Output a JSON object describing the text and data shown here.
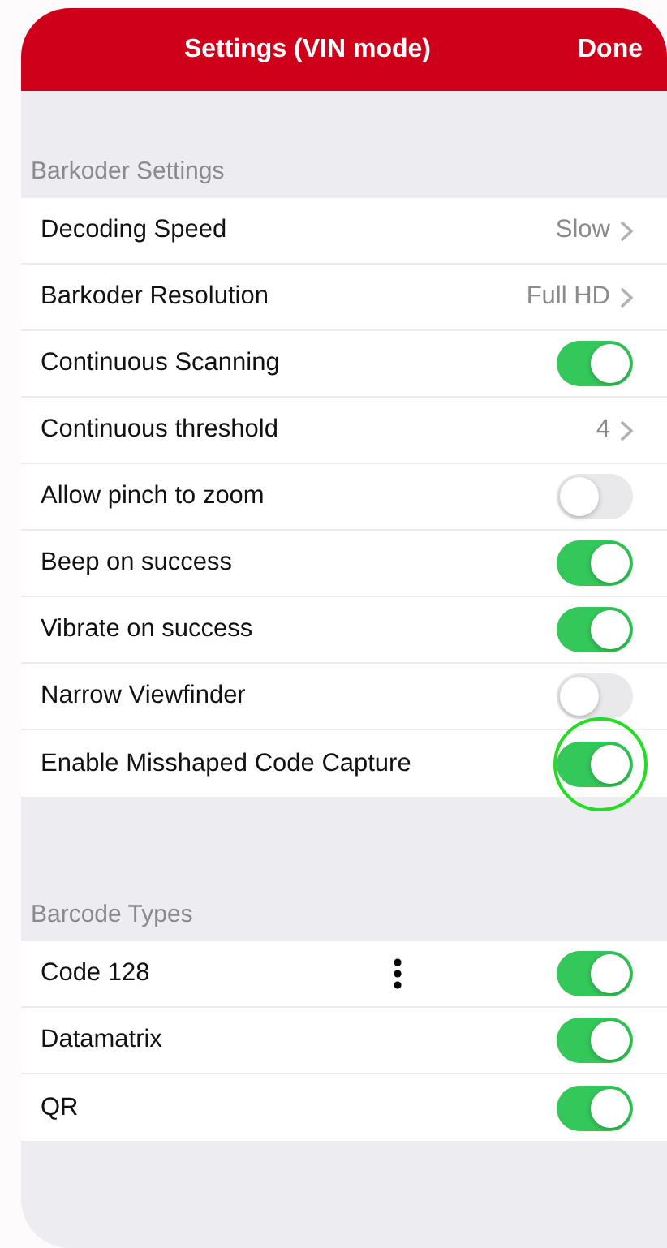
{
  "header": {
    "title": "Settings (VIN mode)",
    "action": "Done"
  },
  "sections": [
    {
      "title": "Barkoder Settings",
      "rows": [
        {
          "kind": "value",
          "label": "Decoding Speed",
          "value": "Slow"
        },
        {
          "kind": "value",
          "label": "Barkoder Resolution",
          "value": "Full HD"
        },
        {
          "kind": "toggle",
          "label": "Continuous Scanning",
          "on": true,
          "highlighted": false
        },
        {
          "kind": "value",
          "label": "Continuous threshold",
          "value": "4"
        },
        {
          "kind": "toggle",
          "label": "Allow pinch to zoom",
          "on": false,
          "highlighted": false
        },
        {
          "kind": "toggle",
          "label": "Beep on success",
          "on": true,
          "highlighted": false
        },
        {
          "kind": "toggle",
          "label": "Vibrate on success",
          "on": true,
          "highlighted": false
        },
        {
          "kind": "toggle",
          "label": "Narrow Viewfinder",
          "on": false,
          "highlighted": false
        },
        {
          "kind": "toggle",
          "label": "Enable Misshaped Code Capture",
          "on": true,
          "highlighted": true
        }
      ]
    },
    {
      "title": "Barcode Types",
      "rows": [
        {
          "kind": "toggle",
          "label": "Code 128",
          "on": true,
          "highlighted": false,
          "menu": true
        },
        {
          "kind": "toggle",
          "label": "Datamatrix",
          "on": true,
          "highlighted": false,
          "menu": false
        },
        {
          "kind": "toggle",
          "label": "QR",
          "on": true,
          "highlighted": false,
          "menu": false
        }
      ]
    }
  ]
}
